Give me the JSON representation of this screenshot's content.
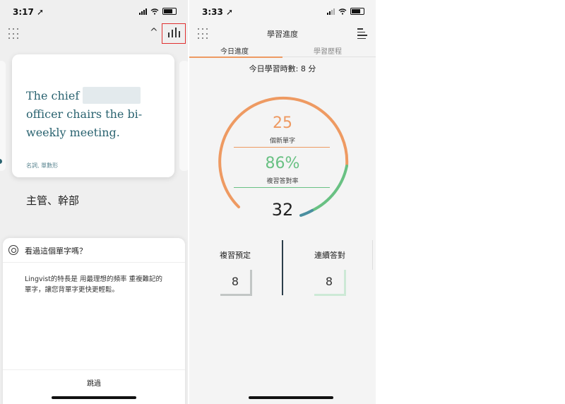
{
  "left_phone": {
    "status": {
      "time": "3:17 ➚"
    },
    "card": {
      "sentence_before": "The chief",
      "sentence_after": "officer chairs the bi-weekly meeting.",
      "part_of_speech": "名詞, 單數形"
    },
    "translation": "主管、幹部",
    "sheet": {
      "title": "看過這個單字嗎？",
      "body": "Lingvist的特長是 用最理想的頻率 重複難記的單字，讓您背單字更快更輕鬆。",
      "skip_label": "跳過"
    }
  },
  "right_phone": {
    "status": {
      "time": "3:33 ➚"
    },
    "title": "學習進度",
    "tabs": [
      "今日進度",
      "學習歷程"
    ],
    "study_time": "今日學習時數: 8 分",
    "gauge": {
      "new_words_value": "25",
      "new_words_label": "個新單字",
      "accuracy_value": "86%",
      "accuracy_label": "複習答對率",
      "center_value": "32"
    },
    "review_scheduled": {
      "label": "複習預定",
      "value": "8"
    },
    "streak": {
      "label": "連續答對",
      "value": "8"
    }
  },
  "colors": {
    "accent_orange": "#ee9a62",
    "accent_green": "#69c183",
    "teal": "#2a6370",
    "highlight_red": "#e03030"
  },
  "icons": [
    "dots-grid-icon",
    "chevron-up-icon",
    "bar-chart-icon",
    "lifebuoy-icon",
    "menu-icon",
    "wifi-icon",
    "battery-icon"
  ]
}
